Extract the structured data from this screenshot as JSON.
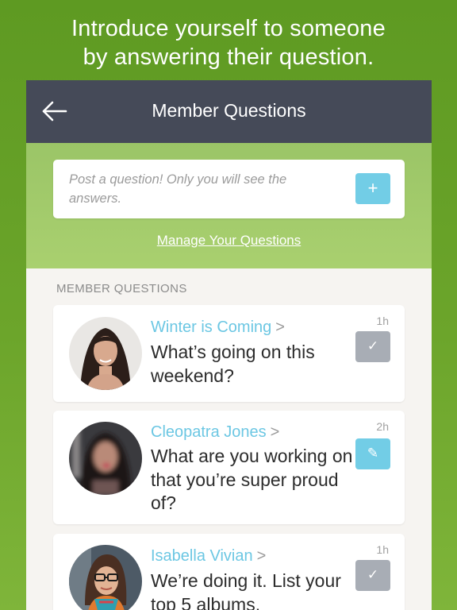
{
  "promo": {
    "line1": "Introduce yourself to someone",
    "line2": "by answering their question."
  },
  "navbar": {
    "title": "Member Questions",
    "back_icon": "arrow-left-icon"
  },
  "post": {
    "placeholder": "Post a question! Only you will see the answers.",
    "add_label": "+",
    "manage_link": "Manage Your Questions"
  },
  "section": {
    "label": "MEMBER QUESTIONS"
  },
  "questions": [
    {
      "name": "Winter is Coming",
      "chevron": ">",
      "question": "What’s going on this weekend?",
      "time": "1h",
      "action_icon": "checkmark-icon",
      "action_glyph": "✓",
      "action_color": "#a8adb5"
    },
    {
      "name": "Cleopatra Jones",
      "chevron": ">",
      "question": "What are you working on that you’re super proud of?",
      "time": "2h",
      "action_icon": "pencil-icon",
      "action_glyph": "✎",
      "action_color": "#72cde6"
    },
    {
      "name": "Isabella Vivian",
      "chevron": ">",
      "question": "We’re doing it. List your top 5 albums.",
      "time": "1h",
      "action_icon": "checkmark-icon",
      "action_glyph": "✓",
      "action_color": "#a8adb5"
    }
  ],
  "colors": {
    "background_green": "#6ca52b",
    "navbar": "#454a58",
    "accent_blue": "#72cde6",
    "name_blue": "#6cc7e3"
  }
}
